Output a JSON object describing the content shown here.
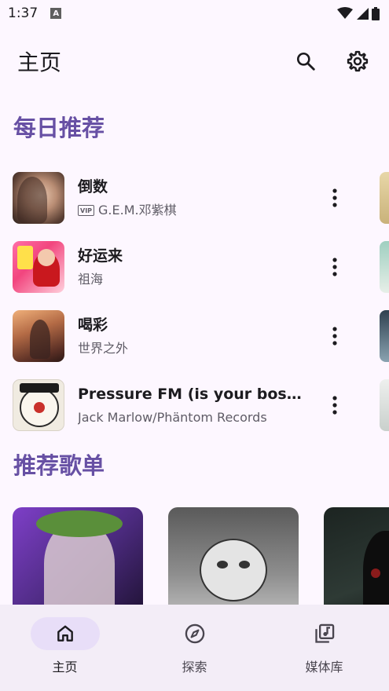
{
  "status_bar": {
    "time": "1:37",
    "icons": [
      "a-notification-icon",
      "wifi-icon",
      "signal-icon",
      "battery-icon"
    ]
  },
  "header": {
    "title": "主页",
    "actions": [
      "search-icon",
      "settings-gear-icon"
    ]
  },
  "daily": {
    "heading": "每日推荐",
    "songs": [
      {
        "title": "倒数",
        "vip": true,
        "vip_label": "VIP",
        "artist": "G.E.M.邓紫棋"
      },
      {
        "title": "好运来",
        "vip": false,
        "artist": "祖海"
      },
      {
        "title": "喝彩",
        "vip": false,
        "artist": "世界之外"
      },
      {
        "title": "Pressure FM (is your boss be…",
        "vip": false,
        "artist": "Jack Marlow/Phäntom Records"
      }
    ]
  },
  "playlists": {
    "heading": "推荐歌单",
    "count_visible": 3
  },
  "bottom_nav": {
    "items": [
      {
        "label": "主页",
        "icon": "home-icon",
        "active": true
      },
      {
        "label": "探索",
        "icon": "compass-icon",
        "active": false
      },
      {
        "label": "媒体库",
        "icon": "library-music-icon",
        "active": false
      }
    ]
  },
  "colors": {
    "accent": "#6750a4",
    "background": "#fdf7ff",
    "nav_background": "#f3edf7",
    "nav_active_pill": "#e8def8"
  }
}
